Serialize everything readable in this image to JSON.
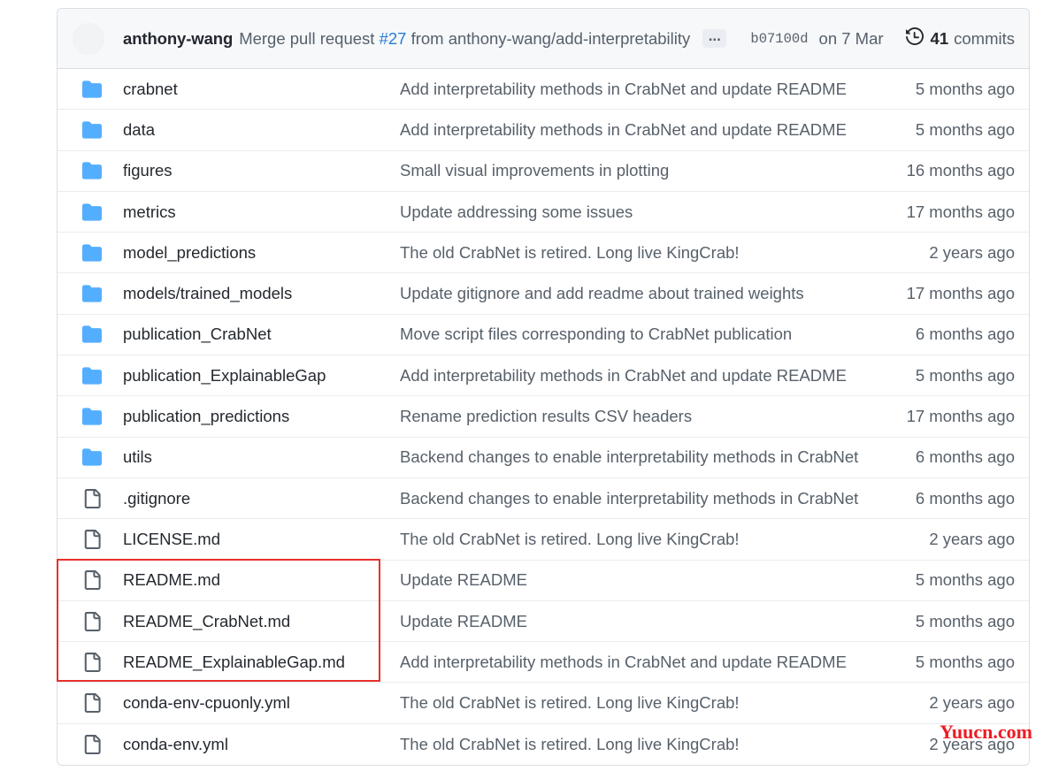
{
  "commit_header": {
    "author": "anthony-wang",
    "message_prefix": "Merge pull request ",
    "pr_number": "#27",
    "message_suffix": " from anthony-wang/add-interpretability",
    "ellipsis_label": "...",
    "sha": "b07100d",
    "date": "on 7 Mar",
    "commits_count": "41",
    "commits_label": "commits",
    "history_icon": "history-clock-icon",
    "avatar": "user-avatar"
  },
  "colors": {
    "folder_icon": "#54aeff",
    "file_icon": "#57606a",
    "link": "#2b7bd4",
    "annotation_red": "#e8302b",
    "watermark_red": "#ec1c24",
    "header_bg": "#f6f8fa",
    "border": "#d8dee4",
    "row_border": "#eaecef",
    "text_primary": "#24292f",
    "text_secondary": "#57606a"
  },
  "files": [
    {
      "type": "folder",
      "icon": "folder-icon",
      "name": "crabnet",
      "message": "Add interpretability methods in CrabNet and update README",
      "time": "5 months ago",
      "highlighted": false
    },
    {
      "type": "folder",
      "icon": "folder-icon",
      "name": "data",
      "message": "Add interpretability methods in CrabNet and update README",
      "time": "5 months ago",
      "highlighted": false
    },
    {
      "type": "folder",
      "icon": "folder-icon",
      "name": "figures",
      "message": "Small visual improvements in plotting",
      "time": "16 months ago",
      "highlighted": false
    },
    {
      "type": "folder",
      "icon": "folder-icon",
      "name": "metrics",
      "message": "Update addressing some issues",
      "time": "17 months ago",
      "highlighted": false
    },
    {
      "type": "folder",
      "icon": "folder-icon",
      "name": "model_predictions",
      "message": "The old CrabNet is retired. Long live KingCrab!",
      "time": "2 years ago",
      "highlighted": false
    },
    {
      "type": "folder",
      "icon": "folder-icon",
      "name": "models/trained_models",
      "message": "Update gitignore and add readme about trained weights",
      "time": "17 months ago",
      "highlighted": false
    },
    {
      "type": "folder",
      "icon": "folder-icon",
      "name": "publication_CrabNet",
      "message": "Move script files corresponding to CrabNet publication",
      "time": "6 months ago",
      "highlighted": false
    },
    {
      "type": "folder",
      "icon": "folder-icon",
      "name": "publication_ExplainableGap",
      "message": "Add interpretability methods in CrabNet and update README",
      "time": "5 months ago",
      "highlighted": false
    },
    {
      "type": "folder",
      "icon": "folder-icon",
      "name": "publication_predictions",
      "message": "Rename prediction results CSV headers",
      "time": "17 months ago",
      "highlighted": false
    },
    {
      "type": "folder",
      "icon": "folder-icon",
      "name": "utils",
      "message": "Backend changes to enable interpretability methods in CrabNet",
      "time": "6 months ago",
      "highlighted": false
    },
    {
      "type": "file",
      "icon": "file-icon",
      "name": ".gitignore",
      "message": "Backend changes to enable interpretability methods in CrabNet",
      "time": "6 months ago",
      "highlighted": false
    },
    {
      "type": "file",
      "icon": "file-icon",
      "name": "LICENSE.md",
      "message": "The old CrabNet is retired. Long live KingCrab!",
      "time": "2 years ago",
      "highlighted": false
    },
    {
      "type": "file",
      "icon": "file-icon",
      "name": "README.md",
      "message": "Update README",
      "time": "5 months ago",
      "highlighted": true
    },
    {
      "type": "file",
      "icon": "file-icon",
      "name": "README_CrabNet.md",
      "message": "Update README",
      "time": "5 months ago",
      "highlighted": true
    },
    {
      "type": "file",
      "icon": "file-icon",
      "name": "README_ExplainableGap.md",
      "message": "Add interpretability methods in CrabNet and update README",
      "time": "5 months ago",
      "highlighted": true
    },
    {
      "type": "file",
      "icon": "file-icon",
      "name": "conda-env-cpuonly.yml",
      "message": "The old CrabNet is retired. Long live KingCrab!",
      "time": "2 years ago",
      "highlighted": false
    },
    {
      "type": "file",
      "icon": "file-icon",
      "name": "conda-env.yml",
      "message": "The old CrabNet is retired. Long live KingCrab!",
      "time": "2 years ago",
      "highlighted": false
    }
  ],
  "watermark": {
    "text": "Yuucn.com"
  }
}
